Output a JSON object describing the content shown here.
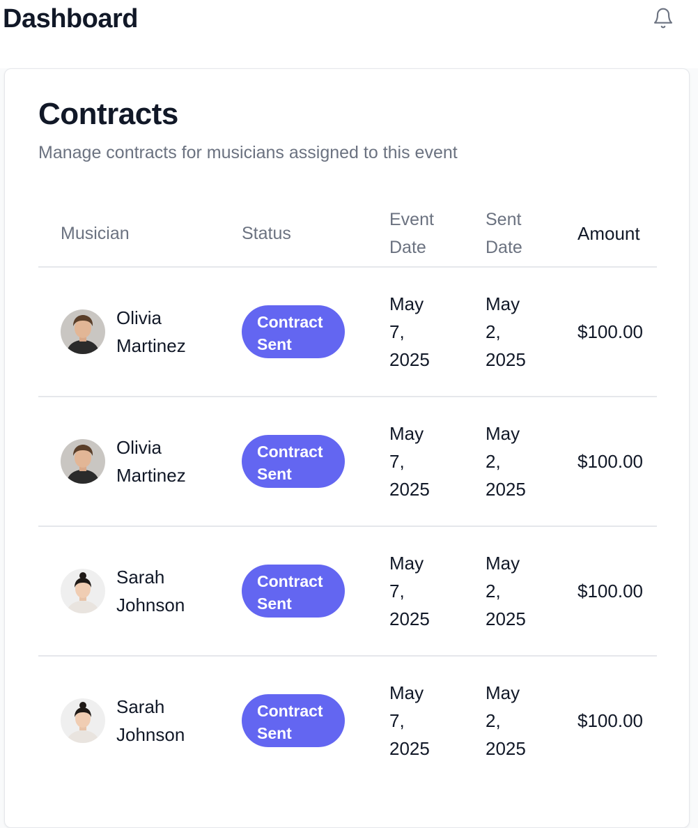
{
  "header": {
    "title": "Dashboard",
    "notification_icon": "bell-icon"
  },
  "contracts": {
    "title": "Contracts",
    "subtitle": "Manage contracts for musicians assigned to this event",
    "columns": {
      "musician": "Musician",
      "status": "Status",
      "event_date": "Event Date",
      "sent_date": "Sent Date",
      "amount": "Amount"
    },
    "rows": [
      {
        "name": "Olivia Martinez",
        "status": "Contract Sent",
        "event_date": "May 7, 2025",
        "sent_date": "May 2, 2025",
        "amount": "$100.00"
      },
      {
        "name": "Olivia Martinez",
        "status": "Contract Sent",
        "event_date": "May 7, 2025",
        "sent_date": "May 2, 2025",
        "amount": "$100.00"
      },
      {
        "name": "Sarah Johnson",
        "status": "Contract Sent",
        "event_date": "May 7, 2025",
        "sent_date": "May 2, 2025",
        "amount": "$100.00"
      },
      {
        "name": "Sarah Johnson",
        "status": "Contract Sent",
        "event_date": "May 7, 2025",
        "sent_date": "May 2, 2025",
        "amount": "$100.00"
      }
    ]
  },
  "colors": {
    "badge": "#6366f1",
    "muted_text": "#6b7280",
    "text": "#111827",
    "border": "#e5e7eb"
  }
}
